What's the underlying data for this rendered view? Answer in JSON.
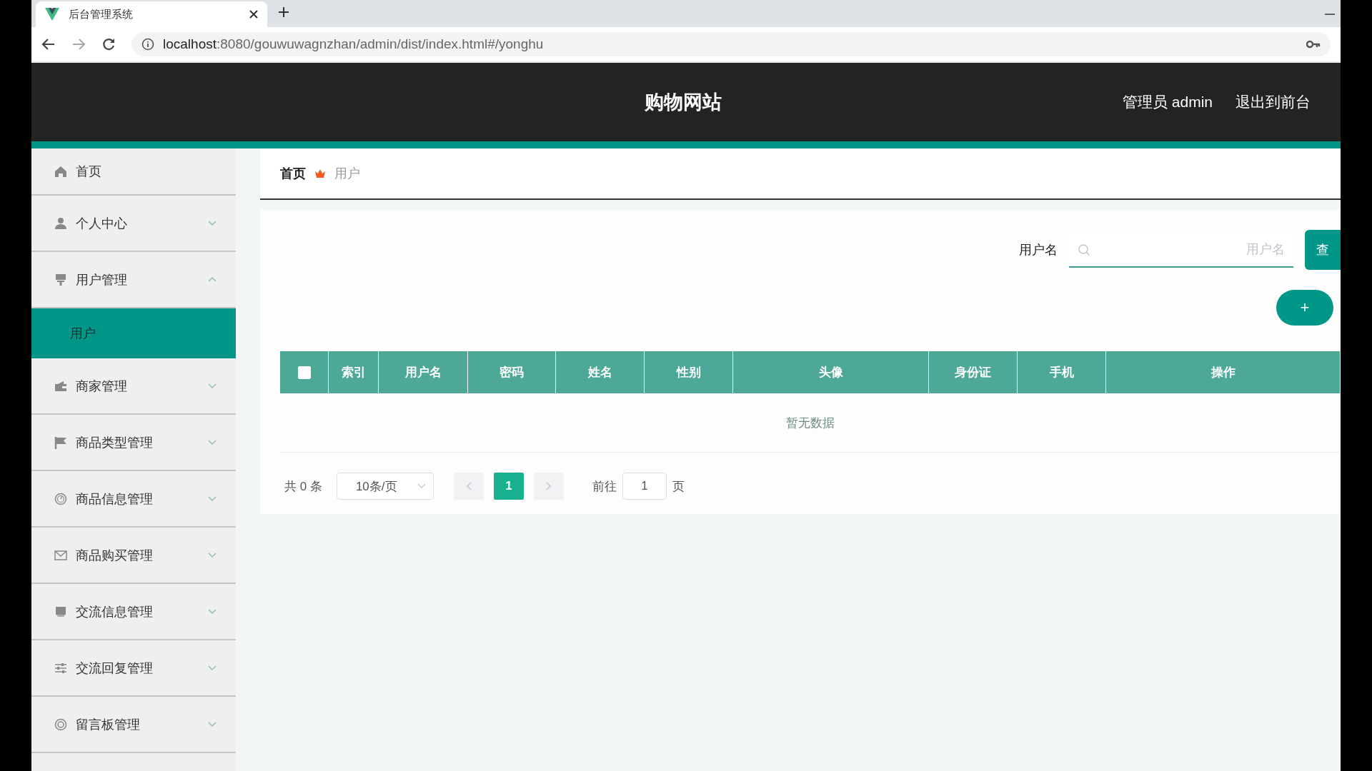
{
  "browser": {
    "tab_title": "后台管理系统",
    "url_host": "localhost",
    "url_path": ":8080/gouwuwagnzhan/admin/dist/index.html#/yonghu"
  },
  "header": {
    "title": "购物网站",
    "links": [
      "管理员 admin",
      "退出到前台"
    ]
  },
  "sidebar": {
    "items": [
      {
        "label": "首页",
        "kind": "link"
      },
      {
        "label": "个人中心",
        "kind": "menu",
        "expanded": false
      },
      {
        "label": "用户管理",
        "kind": "menu",
        "expanded": true,
        "children": [
          {
            "label": "用户",
            "selected": true
          }
        ]
      },
      {
        "label": "商家管理",
        "kind": "menu",
        "expanded": false
      },
      {
        "label": "商品类型管理",
        "kind": "menu",
        "expanded": false
      },
      {
        "label": "商品信息管理",
        "kind": "menu",
        "expanded": false
      },
      {
        "label": "商品购买管理",
        "kind": "menu",
        "expanded": false
      },
      {
        "label": "交流信息管理",
        "kind": "menu",
        "expanded": false
      },
      {
        "label": "交流回复管理",
        "kind": "menu",
        "expanded": false
      },
      {
        "label": "留言板管理",
        "kind": "menu",
        "expanded": false
      }
    ]
  },
  "breadcrumb": [
    {
      "label": "首页",
      "current": false
    },
    {
      "label": "用户",
      "current": true
    }
  ],
  "search": {
    "label": "用户名",
    "placeholder": "用户名",
    "button": "查"
  },
  "add_button": "+",
  "table": {
    "select_all": false,
    "columns": [
      "索引",
      "用户名",
      "密码",
      "姓名",
      "性别",
      "头像",
      "身份证",
      "手机",
      "操作"
    ],
    "empty_text": "暂无数据"
  },
  "pagination": {
    "total": "共 0 条",
    "page_size": "10条/页",
    "pages": [
      {
        "label": "1",
        "selected": true
      }
    ],
    "goto_label": "前往",
    "goto_value": "1",
    "page_unit": "页"
  }
}
